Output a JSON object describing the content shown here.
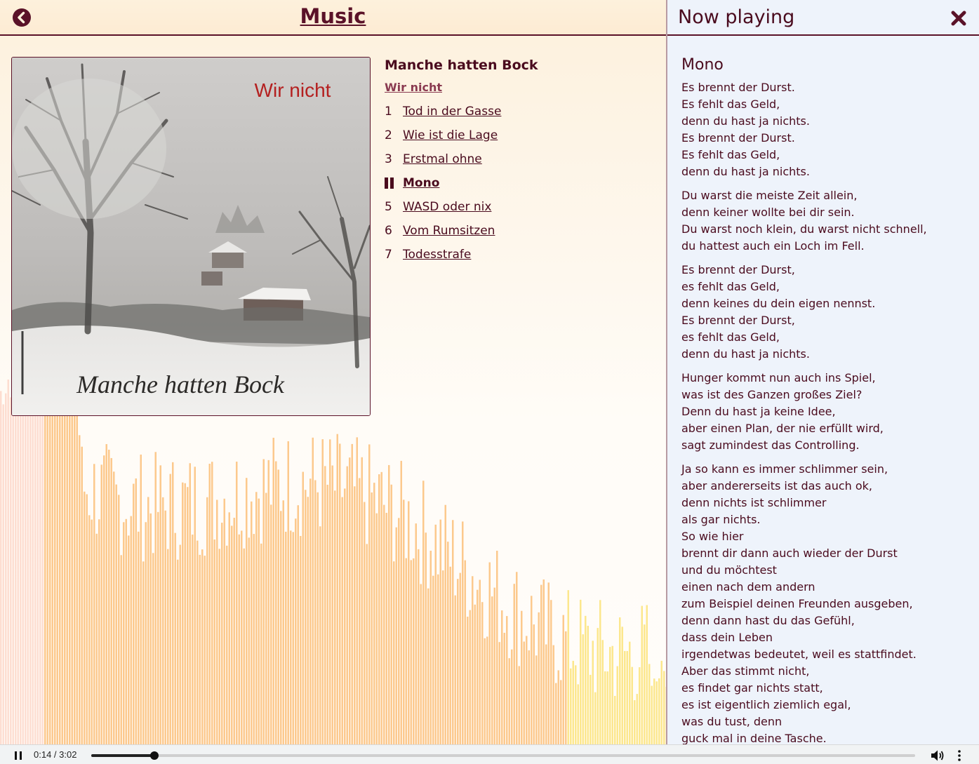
{
  "header": {
    "title": "Music",
    "back_icon": "chevron-left-circle-icon"
  },
  "album": {
    "name": "Manche hatten Bock",
    "artist": "Wir nicht",
    "cover_text_top": "Wir nicht",
    "cover_text_bottom": "Manche hatten Bock",
    "tracks": [
      {
        "num": "1",
        "title": "Tod in der Gasse",
        "playing": false
      },
      {
        "num": "2",
        "title": "Wie ist die Lage",
        "playing": false
      },
      {
        "num": "3",
        "title": "Erstmal ohne",
        "playing": false
      },
      {
        "num": "4",
        "title": "Mono",
        "playing": true
      },
      {
        "num": "5",
        "title": "WASD oder nix",
        "playing": false
      },
      {
        "num": "6",
        "title": "Vom Rumsitzen",
        "playing": false
      },
      {
        "num": "7",
        "title": "Todesstrafe",
        "playing": false
      }
    ]
  },
  "now_playing": {
    "title": "Now playing",
    "close_icon": "close-icon",
    "song_title": "Mono",
    "stanzas": [
      [
        "Es brennt der Durst.",
        "Es fehlt das Geld,",
        "denn du hast ja nichts.",
        "Es brennt der Durst.",
        "Es fehlt das Geld,",
        "denn du hast ja nichts."
      ],
      [
        "Du warst die meiste Zeit allein,",
        "denn keiner wollte bei dir sein.",
        "Du warst noch klein, du warst nicht schnell,",
        "du hattest auch ein Loch im Fell."
      ],
      [
        "Es brennt der Durst,",
        "es fehlt das Geld,",
        "denn keines du dein eigen nennst.",
        "Es brennt der Durst,",
        "es fehlt das Geld,",
        "denn du hast ja nichts."
      ],
      [
        "Hunger kommt nun auch ins Spiel,",
        "was ist des Ganzen großes Ziel?",
        "Denn du hast ja keine Idee,",
        "aber einen Plan, der nie erfüllt wird,",
        "sagt zumindest das Controlling."
      ],
      [
        "Ja so kann es immer schlimmer sein,",
        "aber andererseits ist das auch ok,",
        "denn nichts ist schlimmer",
        "als gar nichts.",
        "So wie hier",
        "brennt dir dann auch wieder der Durst",
        "und du möchtest",
        "einen nach dem andern",
        "zum Beispiel deinen Freunden ausgeben,",
        "denn dann hast du das Gefühl,",
        "dass dein Leben",
        "irgendetwas bedeutet, weil es stattfindet.",
        "Aber das stimmt nicht,",
        "es findet gar nichts statt,",
        "es ist eigentlich ziemlich egal,",
        "was du tust, denn",
        "guck mal in deine Tasche."
      ]
    ]
  },
  "player": {
    "time": "0:14 / 3:02",
    "progress": 0.077,
    "play_state_icon": "pause-icon",
    "volume_icon": "volume-icon",
    "menu_icon": "more-vertical-icon"
  },
  "colors": {
    "accent": "#5a1228",
    "text": "#4a0b1e",
    "visualizer_warm": "#fbbf7a",
    "visualizer_yellow": "#fce37a"
  }
}
